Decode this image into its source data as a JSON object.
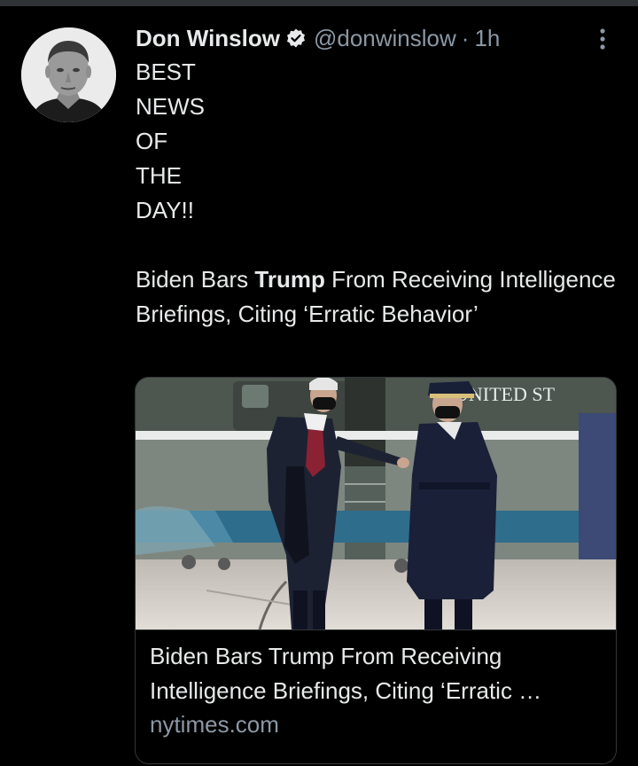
{
  "tweet": {
    "display_name": "Don Winslow",
    "handle": "@donwinslow",
    "separator": "·",
    "time": "1h",
    "lines": [
      "BEST",
      "NEWS",
      "OF",
      "THE",
      "DAY!!"
    ],
    "headline_before": "Biden Bars ",
    "headline_bold": "Trump",
    "headline_after": " From Receiving Intelligence Briefings, Citing ‘Erratic Behavior’"
  },
  "card": {
    "image_sign_text": "UNITED ST",
    "title_line1": "Biden Bars Trump From Receiving",
    "title_line2": "Intelligence Briefings, Citing ‘Erratic …",
    "domain": "nytimes.com"
  },
  "colors": {
    "background": "#000000",
    "primary_text": "#e7e9ea",
    "secondary_text": "#8b98a5",
    "border": "#333639"
  },
  "icons": {
    "verified": "verified-badge-icon",
    "more": "more-vertical-icon"
  }
}
